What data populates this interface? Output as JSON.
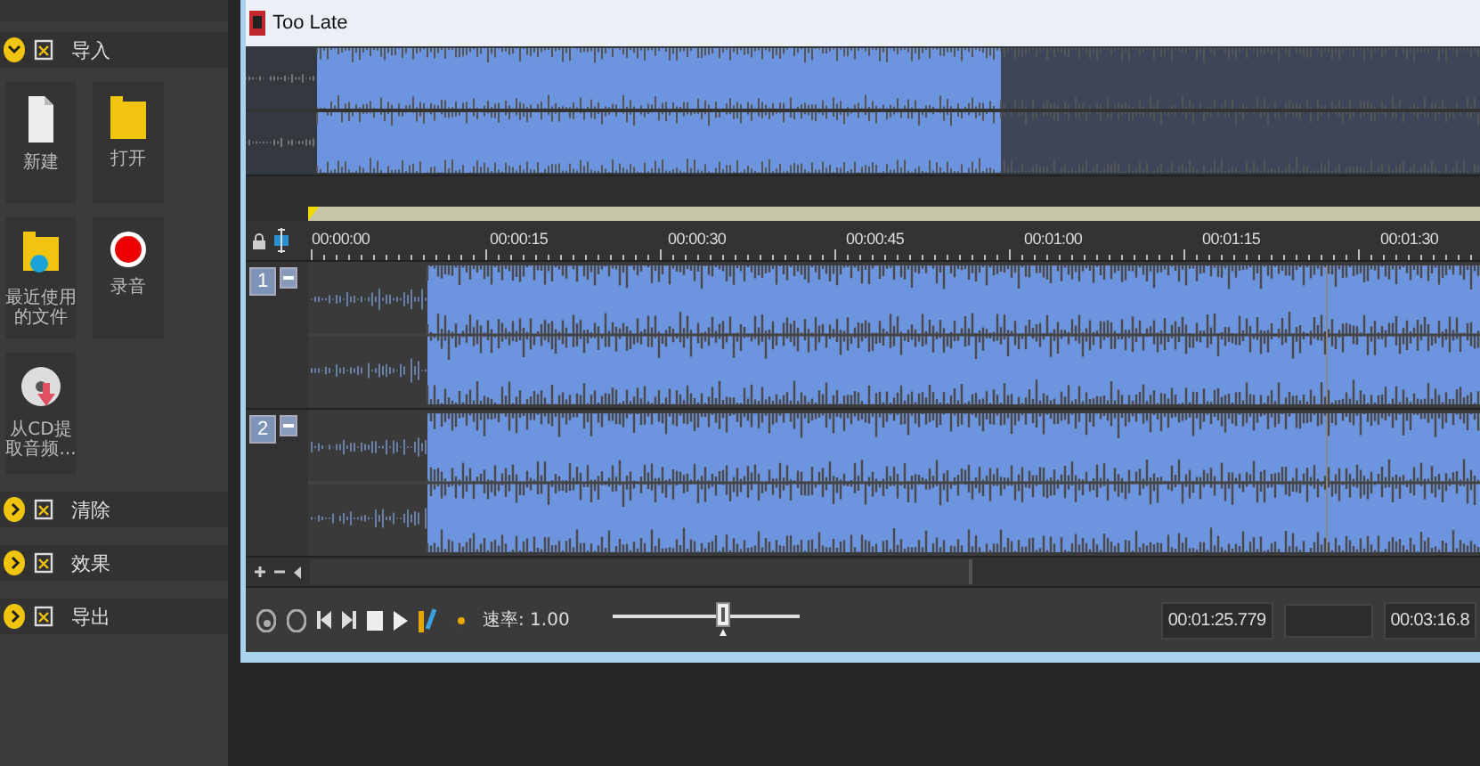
{
  "sidebar": {
    "sections": [
      {
        "label": "导入",
        "expanded": true,
        "items": [
          {
            "label": "新建",
            "kind": "new-file"
          },
          {
            "label": "打开",
            "kind": "folder"
          },
          {
            "label": "最近使用的文件",
            "kind": "recent"
          },
          {
            "label": "录音",
            "kind": "record"
          },
          {
            "label": "从CD提取音频...",
            "kind": "cd"
          }
        ]
      },
      {
        "label": "清除",
        "expanded": false
      },
      {
        "label": "效果",
        "expanded": false
      },
      {
        "label": "导出",
        "expanded": false
      }
    ]
  },
  "window": {
    "title": "Too Late"
  },
  "timeline": {
    "ticks": [
      "00:00:00",
      "00:00:15",
      "00:00:30",
      "00:00:45",
      "00:01:00",
      "00:01:15",
      "00:01:30"
    ]
  },
  "tracks": [
    {
      "number": "1"
    },
    {
      "number": "2"
    }
  ],
  "transport": {
    "speed_label": "速率: 1.00",
    "speed": {
      "level": 0.59
    },
    "position": "00:01:25.779",
    "length": "00:03:16.8"
  }
}
